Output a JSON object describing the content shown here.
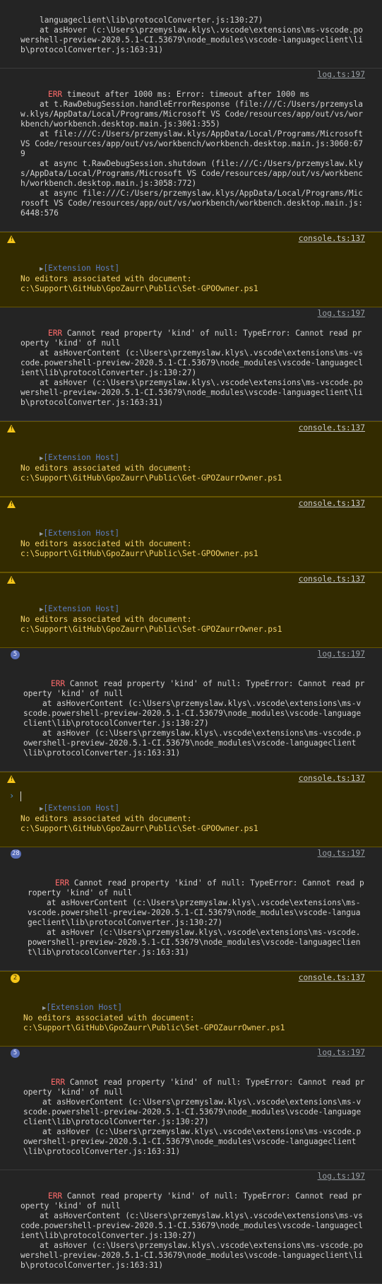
{
  "entries": [
    {
      "kind": "plain",
      "text": "languageclient\\lib\\protocolConverter.js:130:27)\n    at asHover (c:\\Users\\przemyslaw.klys\\.vscode\\extensions\\ms-vscode.powershell-preview-2020.5.1-CI.53679\\node_modules\\vscode-languageclient\\lib\\protocolConverter.js:163:31)"
    },
    {
      "kind": "err",
      "source": "log.ts:197",
      "label": "ERR",
      "text": " timeout after 1000 ms: Error: timeout after 1000 ms\n    at t.RawDebugSession.handleErrorResponse (file:///C:/Users/przemyslaw.klys/AppData/Local/Programs/Microsoft VS Code/resources/app/out/vs/workbench/workbench.desktop.main.js:3061:355)\n    at file:///C:/Users/przemyslaw.klys/AppData/Local/Programs/Microsoft VS Code/resources/app/out/vs/workbench/workbench.desktop.main.js:3060:679\n    at async t.RawDebugSession.shutdown (file:///C:/Users/przemyslaw.klys/AppData/Local/Programs/Microsoft VS Code/resources/app/out/vs/workbench/workbench.desktop.main.js:3058:772)\n    at async file:///C:/Users/przemyslaw.klys/AppData/Local/Programs/Microsoft VS Code/resources/app/out/vs/workbench/workbench.desktop.main.js:6448:576"
    },
    {
      "kind": "warn",
      "source": "console.ts:137",
      "ext": "[Extension Host]",
      "text": "No editors associated with document:\nc:\\Support\\GitHub\\GpoZaurr\\Public\\Set-GPOOwner.ps1"
    },
    {
      "kind": "err",
      "source": "log.ts:197",
      "label": "ERR",
      "text": " Cannot read property 'kind' of null: TypeError: Cannot read property 'kind' of null\n    at asHoverContent (c:\\Users\\przemyslaw.klys\\.vscode\\extensions\\ms-vscode.powershell-preview-2020.5.1-CI.53679\\node_modules\\vscode-languageclient\\lib\\protocolConverter.js:130:27)\n    at asHover (c:\\Users\\przemyslaw.klys\\.vscode\\extensions\\ms-vscode.powershell-preview-2020.5.1-CI.53679\\node_modules\\vscode-languageclient\\lib\\protocolConverter.js:163:31)"
    },
    {
      "kind": "warn",
      "source": "console.ts:137",
      "ext": "[Extension Host]",
      "text": "No editors associated with document:\nc:\\Support\\GitHub\\GpoZaurr\\Public\\Get-GPOZaurrOwner.ps1"
    },
    {
      "kind": "warn",
      "source": "console.ts:137",
      "ext": "[Extension Host]",
      "text": "No editors associated with document:\nc:\\Support\\GitHub\\GpoZaurr\\Public\\Set-GPOOwner.ps1"
    },
    {
      "kind": "warn",
      "source": "console.ts:137",
      "ext": "[Extension Host]",
      "text": "No editors associated with document:\nc:\\Support\\GitHub\\GpoZaurr\\Public\\Set-GPOZaurrOwner.ps1"
    },
    {
      "kind": "err",
      "badge": "5",
      "source": "log.ts:197",
      "label": "ERR",
      "text": " Cannot read property 'kind' of null: TypeError: Cannot read property 'kind' of null\n    at asHoverContent (c:\\Users\\przemyslaw.klys\\.vscode\\extensions\\ms-vscode.powershell-preview-2020.5.1-CI.53679\\node_modules\\vscode-languageclient\\lib\\protocolConverter.js:130:27)\n    at asHover (c:\\Users\\przemyslaw.klys\\.vscode\\extensions\\ms-vscode.powershell-preview-2020.5.1-CI.53679\\node_modules\\vscode-languageclient\\lib\\protocolConverter.js:163:31)"
    },
    {
      "kind": "warn",
      "source": "console.ts:137",
      "ext": "[Extension Host]",
      "text": "No editors associated with document:\nc:\\Support\\GitHub\\GpoZaurr\\Public\\Set-GPOOwner.ps1"
    },
    {
      "kind": "err",
      "badge": "28",
      "source": "log.ts:197",
      "label": "ERR",
      "text": " Cannot read property 'kind' of null: TypeError: Cannot read property 'kind' of null\n    at asHoverContent (c:\\Users\\przemyslaw.klys\\.vscode\\extensions\\ms-vscode.powershell-preview-2020.5.1-CI.53679\\node_modules\\vscode-languageclient\\lib\\protocolConverter.js:130:27)\n    at asHover (c:\\Users\\przemyslaw.klys\\.vscode\\extensions\\ms-vscode.powershell-preview-2020.5.1-CI.53679\\node_modules\\vscode-languageclient\\lib\\protocolConverter.js:163:31)"
    },
    {
      "kind": "warn",
      "badge": "2",
      "source": "console.ts:137",
      "ext": "[Extension Host]",
      "text": "No editors associated with document:\nc:\\Support\\GitHub\\GpoZaurr\\Public\\Set-GPOZaurrOwner.ps1"
    },
    {
      "kind": "err",
      "badge": "5",
      "source": "log.ts:197",
      "label": "ERR",
      "text": " Cannot read property 'kind' of null: TypeError: Cannot read property 'kind' of null\n    at asHoverContent (c:\\Users\\przemyslaw.klys\\.vscode\\extensions\\ms-vscode.powershell-preview-2020.5.1-CI.53679\\node_modules\\vscode-languageclient\\lib\\protocolConverter.js:130:27)\n    at asHover (c:\\Users\\przemyslaw.klys\\.vscode\\extensions\\ms-vscode.powershell-preview-2020.5.1-CI.53679\\node_modules\\vscode-languageclient\\lib\\protocolConverter.js:163:31)"
    },
    {
      "kind": "err",
      "source": "log.ts:197",
      "label": "ERR",
      "text": " Cannot read property 'kind' of null: TypeError: Cannot read property 'kind' of null\n    at asHoverContent (c:\\Users\\przemyslaw.klys\\.vscode\\extensions\\ms-vscode.powershell-preview-2020.5.1-CI.53679\\node_modules\\vscode-languageclient\\lib\\protocolConverter.js:130:27)\n    at asHover (c:\\Users\\przemyslaw.klys\\.vscode\\extensions\\ms-vscode.powershell-preview-2020.5.1-CI.53679\\node_modules\\vscode-languageclient\\lib\\protocolConverter.js:163:31)"
    }
  ],
  "prompt": {
    "caret": "›"
  },
  "colors": {
    "background": "#242424",
    "warning_bg": "#332b00",
    "warning_text": "#f5d36b",
    "error_label": "#ff6b6b",
    "badge_blue": "#5a6fb8",
    "badge_yellow": "#f5c518"
  }
}
